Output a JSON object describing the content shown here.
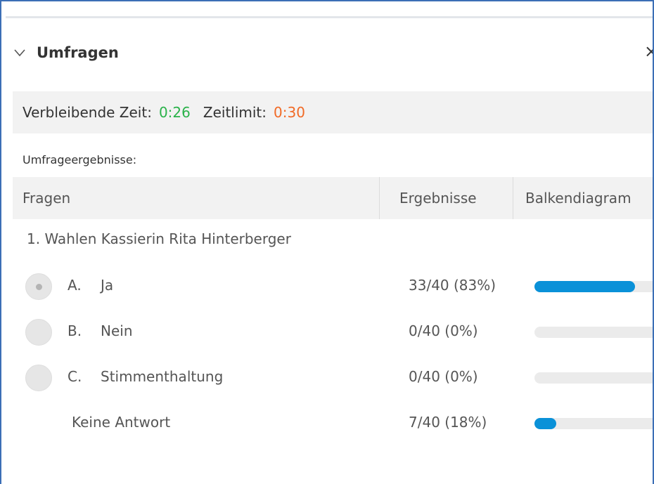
{
  "panel": {
    "title": "Umfragen",
    "close_symbol": "×"
  },
  "timer": {
    "remaining_label": "Verbleibende Zeit:",
    "remaining_value": "0:26",
    "limit_label": "Zeitlimit:",
    "limit_value": "0:30",
    "remaining_color": "#2ab24a",
    "limit_color": "#f16a26"
  },
  "results_label": "Umfrageergebnisse:",
  "table": {
    "columns": [
      "Fragen",
      "Ergebnisse",
      "Balkendiagram"
    ]
  },
  "question": {
    "text": "1. Wahlen Kassierin Rita Hinterberger",
    "options": [
      {
        "letter": "A.",
        "label": "Ja",
        "result": "33/40 (83%)",
        "fraction": 0.83,
        "selected": true
      },
      {
        "letter": "B.",
        "label": "Nein",
        "result": "0/40 (0%)",
        "fraction": 0,
        "selected": false
      },
      {
        "letter": "C.",
        "label": "Stimmenthaltung",
        "result": "0/40 (0%)",
        "fraction": 0,
        "selected": false
      }
    ],
    "no_answer": {
      "label": "Keine Antwort",
      "result": "7/40 (18%)",
      "fraction": 0.18
    }
  },
  "colors": {
    "bar_fill": "#0a91d8",
    "bar_track": "#ebebeb",
    "frame_border": "#3b6fb6"
  }
}
